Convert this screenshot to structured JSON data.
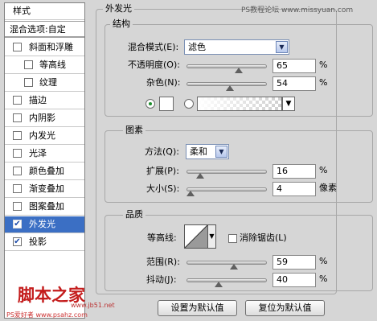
{
  "watermark_top": "PS教程论坛 www.missyuan.com",
  "watermark_bottom": {
    "brand": "脚本之家",
    "url": "www.jb51.net",
    "site": "PS爱好者 www.psahz.com"
  },
  "left_panel": {
    "header": "样式",
    "blend_options": "混合选项:自定",
    "items": [
      {
        "label": "斜面和浮雕",
        "checked": false
      },
      {
        "label": "等高线",
        "checked": false
      },
      {
        "label": "纹理",
        "checked": false
      },
      {
        "label": "描边",
        "checked": false
      },
      {
        "label": "内阴影",
        "checked": false
      },
      {
        "label": "内发光",
        "checked": false
      },
      {
        "label": "光泽",
        "checked": false
      },
      {
        "label": "颜色叠加",
        "checked": false
      },
      {
        "label": "渐变叠加",
        "checked": false
      },
      {
        "label": "图案叠加",
        "checked": false
      },
      {
        "label": "外发光",
        "checked": true
      },
      {
        "label": "投影",
        "checked": true
      }
    ],
    "check_mark": "✔"
  },
  "outer_glow": {
    "title": "外发光",
    "structure": {
      "title": "结构",
      "blend_mode_label": "混合模式(E):",
      "blend_mode_value": "滤色",
      "opacity_label": "不透明度(O):",
      "opacity_value": "65",
      "opacity_level": 0.65,
      "noise_label": "杂色(N):",
      "noise_value": "54",
      "noise_level": 0.54,
      "percent": "%"
    },
    "elements": {
      "title": "图素",
      "method_label": "方法(Q):",
      "method_value": "柔和",
      "spread_label": "扩展(P):",
      "spread_value": "16",
      "spread_level": 0.16,
      "size_label": "大小(S):",
      "size_value": "4",
      "size_unit": "像素",
      "percent": "%"
    },
    "quality": {
      "title": "品质",
      "contour_label": "等高线:",
      "anti_alias_label": "消除锯齿(L)",
      "range_label": "范围(R):",
      "range_value": "59",
      "range_level": 0.59,
      "jitter_label": "抖动(J):",
      "jitter_value": "40",
      "jitter_level": 0.4,
      "percent": "%"
    },
    "buttons": {
      "make_default": "设置为默认值",
      "reset_default": "复位为默认值"
    }
  },
  "colors": {
    "selection": "#3b6fc4",
    "glow_swatch": "#ffffff",
    "radio_dot": "#1c8d2c"
  }
}
